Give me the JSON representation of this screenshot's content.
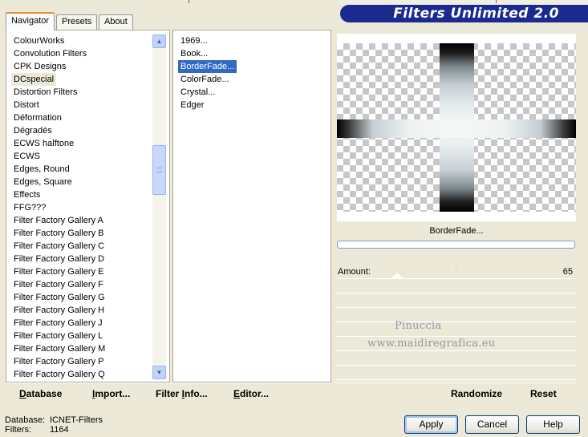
{
  "tabs": [
    {
      "label": "Navigator"
    },
    {
      "label": "Presets"
    },
    {
      "label": "About"
    }
  ],
  "banner": {
    "title": "Filters Unlimited 2.0"
  },
  "categories": [
    "ColourWorks",
    "Convolution Filters",
    "CPK Designs",
    "DCspecial",
    "Distortion Filters",
    "Distort",
    "Déformation",
    "Dégradés",
    "ECWS halftone",
    "ECWS",
    "Edges, Round",
    "Edges, Square",
    "Effects",
    "FFG???",
    "Filter Factory Gallery A",
    "Filter Factory Gallery B",
    "Filter Factory Gallery C",
    "Filter Factory Gallery D",
    "Filter Factory Gallery E",
    "Filter Factory Gallery F",
    "Filter Factory Gallery G",
    "Filter Factory Gallery H",
    "Filter Factory Gallery J",
    "Filter Factory Gallery L",
    "Filter Factory Gallery M",
    "Filter Factory Gallery P",
    "Filter Factory Gallery Q"
  ],
  "filters": [
    "1969...",
    "Book...",
    "BorderFade...",
    "ColorFade...",
    "Crystal...",
    "Edger"
  ],
  "preview": {
    "filter_name": "BorderFade..."
  },
  "parameters": {
    "amount_label": "Amount:",
    "amount_value": "65"
  },
  "watermark": {
    "line1": "Pinuccia",
    "line2": "www.maidiregrafica.eu"
  },
  "left_toolbar": {
    "database": {
      "first": "D",
      "rest": "atabase"
    },
    "import": {
      "first": "I",
      "rest": "mport..."
    },
    "filter_info": {
      "lead": "Filter ",
      "underlined": "I",
      "rest": "nfo..."
    },
    "editor": {
      "first": "E",
      "rest": "ditor..."
    }
  },
  "right_toolbar": {
    "randomize": "Randomize",
    "reset": "Reset"
  },
  "status": {
    "database_label": "Database:",
    "database_value": "ICNET-Filters",
    "filters_label": "Filters:",
    "filters_value": "1164"
  },
  "buttons": {
    "apply": "Apply",
    "cancel": "Cancel",
    "help": "Help"
  }
}
